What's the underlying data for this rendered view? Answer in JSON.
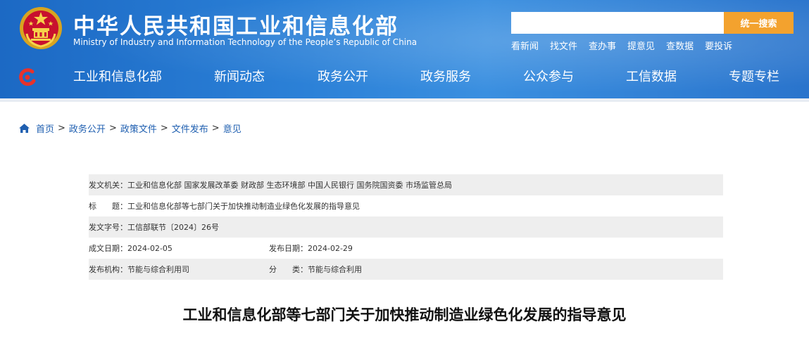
{
  "header": {
    "title": "中华人民共和国工业和信息化部",
    "subtitle": "Ministry of Industry and Information Technology of the People’s Republic of China",
    "search": {
      "placeholder": "",
      "button_label": "统一搜索"
    },
    "quick_links": [
      "看新闻",
      "找文件",
      "查办事",
      "提意见",
      "查数据",
      "要投诉"
    ],
    "icons": {
      "emblem": "national-emblem-icon",
      "nav_logo": "miit-logo-icon"
    },
    "colors": {
      "header_bg": "#2a7fd6",
      "search_button": "#f3a22e"
    }
  },
  "nav": {
    "items": [
      "工业和信息化部",
      "新闻动态",
      "政务公开",
      "政务服务",
      "公众参与",
      "工信数据",
      "专题专栏"
    ]
  },
  "breadcrumb": {
    "home_icon": "home-icon",
    "items": [
      "首页",
      "政务公开",
      "政策文件",
      "文件发布",
      "意见"
    ],
    "separator": ">"
  },
  "meta": {
    "issuer": {
      "label": "发文机关：",
      "value": "工业和信息化部 国家发展改革委 财政部 生态环境部 中国人民银行 国务院国资委 市场监管总局"
    },
    "title": {
      "label": "标　　题：",
      "value": "工业和信息化部等七部门关于加快推动制造业绿色化发展的指导意见"
    },
    "doc_number": {
      "label": "发文字号：",
      "value": "工信部联节〔2024〕26号"
    },
    "written_date": {
      "label": "成文日期：",
      "value": "2024-02-05"
    },
    "publish_date": {
      "label": "发布日期：",
      "value": "2024-02-29"
    },
    "agency": {
      "label": "发布机构：",
      "value": "节能与综合利用司"
    },
    "category": {
      "label": "分　　类：",
      "value": "节能与综合利用"
    }
  },
  "document": {
    "title": "工业和信息化部等七部门关于加快推动制造业绿色化发展的指导意见"
  }
}
